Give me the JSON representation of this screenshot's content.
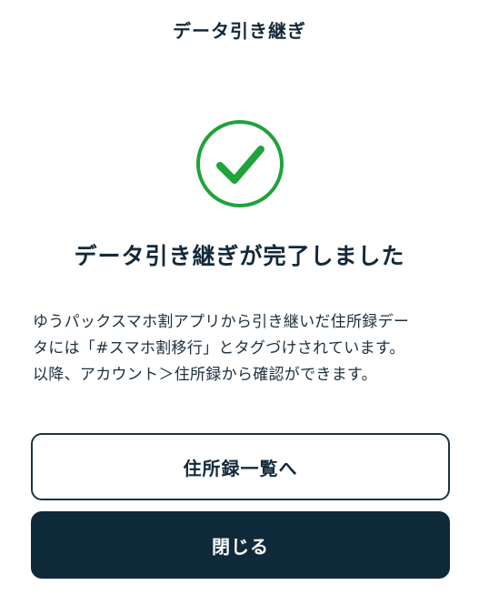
{
  "header": {
    "title": "データ引き継ぎ"
  },
  "status": {
    "icon": "check-circle-icon",
    "color": "#1fa33a",
    "heading": "データ引き継ぎが完了しました"
  },
  "message": {
    "line1": "ゆうパックスマホ割アプリから引き継いだ住所録デー",
    "line2": "タには「#スマホ割移行」とタグづけされています。",
    "line3": "以降、アカウント＞住所録から確認ができます。"
  },
  "actions": {
    "address_list_label": "住所録一覧へ",
    "close_label": "閉じる"
  },
  "colors": {
    "primary": "#0f2a3a",
    "success": "#1fa33a"
  }
}
